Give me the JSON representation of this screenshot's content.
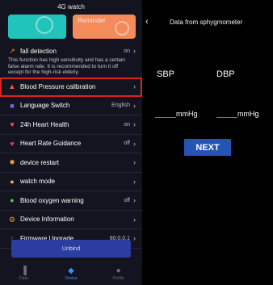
{
  "left": {
    "title": "4G watch",
    "cards": [
      {
        "label": ""
      },
      {
        "label": "Reminder"
      }
    ],
    "fall": {
      "label": "fall detection",
      "value": "on",
      "description": "This function has high sensitivity and has a certain false alarm rate. It is recommended to turn it off except for the high-risk elderly."
    },
    "items": [
      {
        "icon": "blood-pressure-icon",
        "glyph": "▲",
        "color": "#ff5a4a",
        "label": "Blood Pressure calibration",
        "value": ""
      },
      {
        "icon": "language-icon",
        "glyph": "■",
        "color": "#7a62f0",
        "label": "Language Switch",
        "value": "English"
      },
      {
        "icon": "heart-icon",
        "glyph": "♥",
        "color": "#ff4d5e",
        "label": "24h Heart Health",
        "value": "on"
      },
      {
        "icon": "heart-rate-icon",
        "glyph": "♥",
        "color": "#ff3355",
        "label": "Heart Rate Guidance",
        "value": "off"
      },
      {
        "icon": "restart-icon",
        "glyph": "✹",
        "color": "#f7a23b",
        "label": "device restart",
        "value": ""
      },
      {
        "icon": "watch-icon",
        "glyph": "●",
        "color": "#f2b834",
        "label": "watch mode",
        "value": ""
      },
      {
        "icon": "oxygen-icon",
        "glyph": "●",
        "color": "#52c46c",
        "label": "Blood oxygen warning",
        "value": "off"
      },
      {
        "icon": "info-icon",
        "glyph": "⚙",
        "color": "#f29a38",
        "label": "Device Information",
        "value": ""
      },
      {
        "icon": "upgrade-icon",
        "glyph": "↑",
        "color": "#3b8ff7",
        "label": "Firmware Upgrade",
        "value": "80.0.0.1"
      }
    ],
    "unbind_label": "Unbind",
    "tabs": [
      {
        "label": "Data"
      },
      {
        "label": "Device"
      },
      {
        "label": "Profile"
      }
    ]
  },
  "right": {
    "title": "Data from sphygmometer",
    "sbp_label": "SBP",
    "dbp_label": "DBP",
    "sbp_unit": "mmHg",
    "dbp_unit": "mmHg",
    "next_label": "NEXT"
  }
}
